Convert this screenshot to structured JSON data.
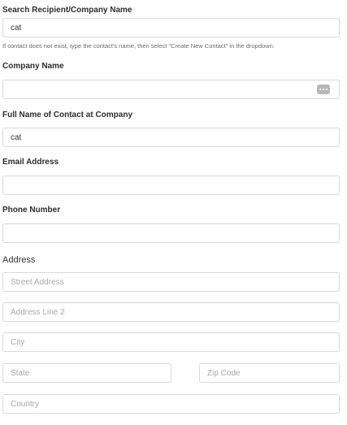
{
  "search": {
    "label": "Search Recipient/Company Name",
    "value": "cat",
    "hint": "If contact does not exist, type the contact's name, then select \"Create New Contact\" in the dropdown."
  },
  "company": {
    "label": "Company Name",
    "value": "",
    "more_icon": "more-horizontal-icon"
  },
  "contact": {
    "label": "Full Name of Contact at Company",
    "value": "cat"
  },
  "email": {
    "label": "Email Address",
    "value": ""
  },
  "phone": {
    "label": "Phone Number",
    "value": ""
  },
  "address": {
    "label": "Address",
    "street_placeholder": "Street Address",
    "line2_placeholder": "Address Line 2",
    "city_placeholder": "City",
    "state_placeholder": "State",
    "zip_placeholder": "Zip Code",
    "country_placeholder": "Country"
  }
}
